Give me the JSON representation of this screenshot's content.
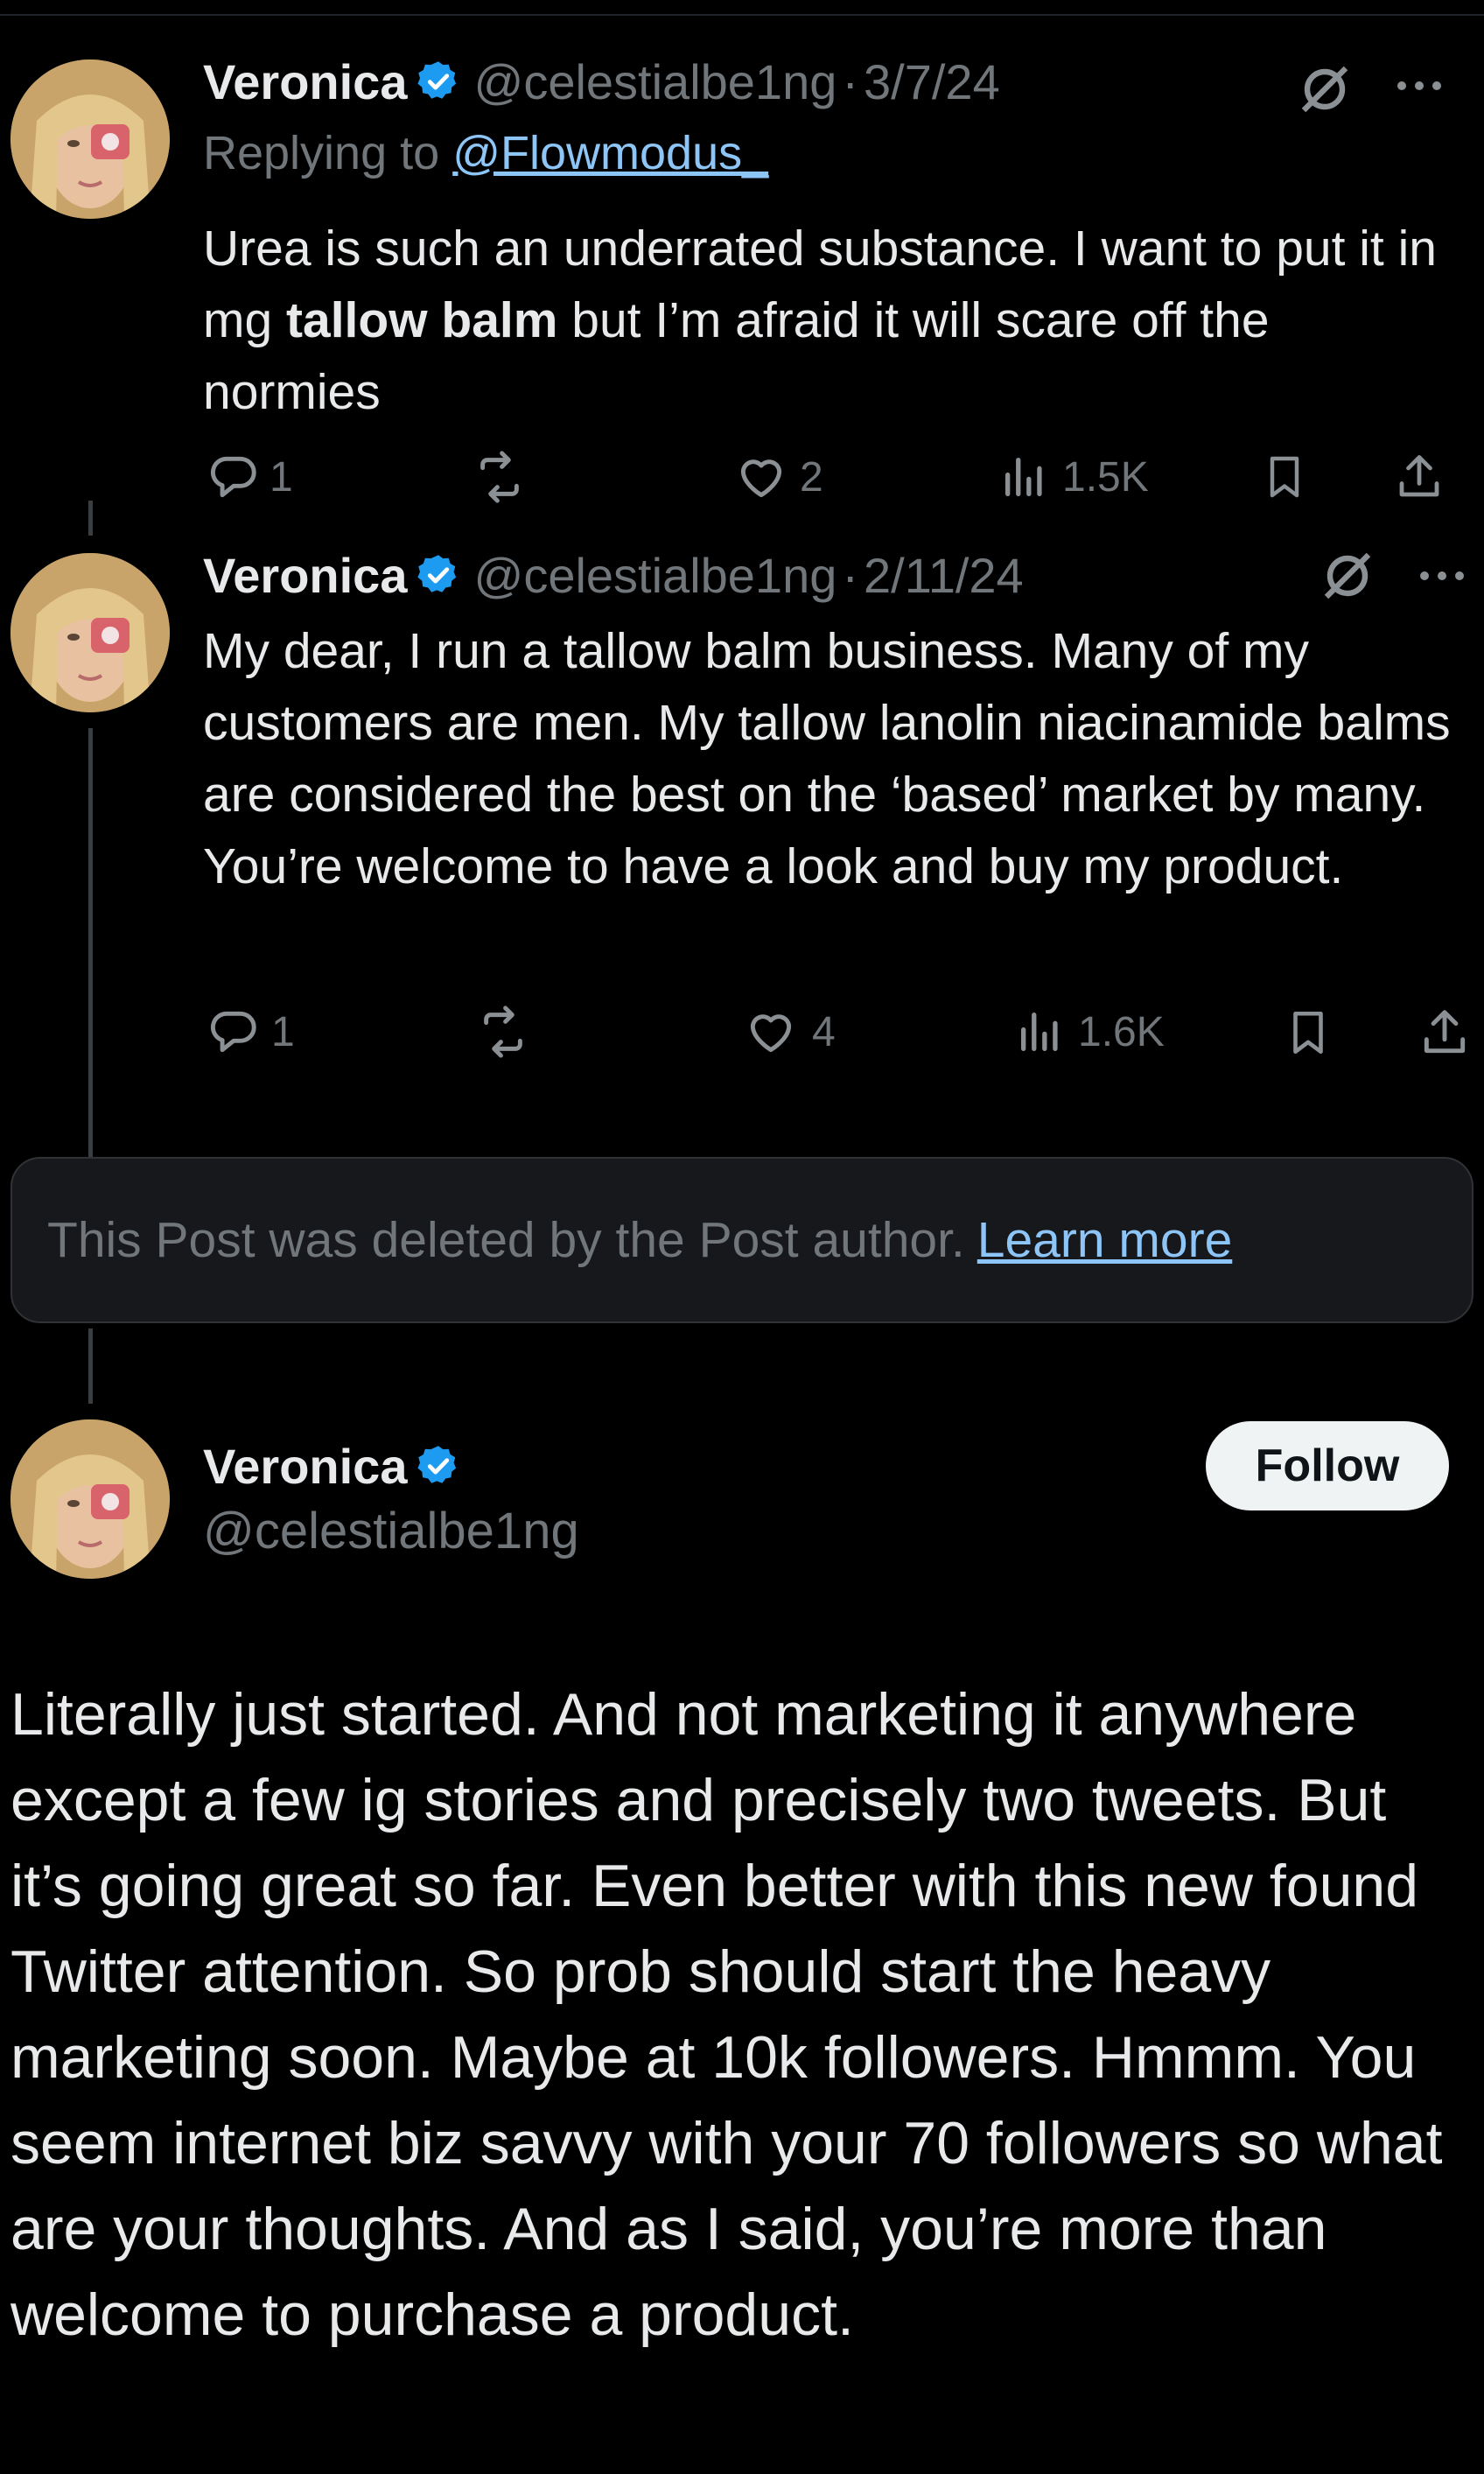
{
  "tweet1": {
    "name": "Veronica",
    "handle": "@celestialbe1ng",
    "separator": "·",
    "date": "3/7/24",
    "replying_prefix": "Replying to",
    "replying_to": "@Flowmodus_",
    "text_part1": "Urea is such an underrated substance. I want to put it in mg ",
    "text_bold": "tallow balm",
    "text_part2": " but I’m afraid it will scare off the normies",
    "replies": "1",
    "likes": "2",
    "views": "1.5K"
  },
  "tweet2": {
    "name": "Veronica",
    "handle": "@celestialbe1ng",
    "separator": "·",
    "date": "2/11/24",
    "text": "My dear, I run a tallow balm business. Many of my customers are men. My tallow lanolin niacinamide balms are considered the best on the ‘based’ market by many. You’re welcome to have a look and buy my product.",
    "replies": "1",
    "likes": "4",
    "views": "1.6K"
  },
  "deleted_notice": {
    "text": "This Post was deleted by the Post author.",
    "link": "Learn more"
  },
  "main_post": {
    "name": "Veronica",
    "handle": "@celestialbe1ng",
    "follow_label": "Follow",
    "text": "Literally just started. And not marketing it anywhere except a few ig stories and precisely two tweets. But it’s going great so far. Even better with this new found Twitter attention. So prob should start the heavy marketing soon. Maybe at 10k followers. Hmmm. You seem internet biz savvy with your 70 followers so what are your thoughts. And as I said, you’re more than welcome to purchase a product."
  },
  "colors": {
    "background": "#000000",
    "text": "#e7e9ea",
    "muted": "#71767b",
    "link": "#8ec5f7",
    "verified": "#1d9bf0"
  },
  "icons": [
    "verified-badge-icon",
    "grok-icon",
    "more-icon",
    "reply-icon",
    "repost-icon",
    "like-icon",
    "views-icon",
    "bookmark-icon",
    "share-icon"
  ]
}
